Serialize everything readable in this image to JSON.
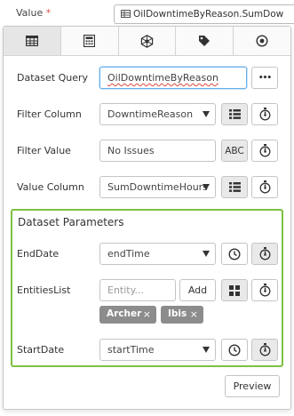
{
  "header": {
    "value_label": "Value",
    "required_mark": "*",
    "value_select": "OilDowntimeByReason.SumDow"
  },
  "tabs": [
    {
      "icon": "table-icon",
      "active": true
    },
    {
      "icon": "calculator-icon",
      "active": false
    },
    {
      "icon": "hexagon-network-icon",
      "active": false
    },
    {
      "icon": "tag-icon",
      "active": false
    },
    {
      "icon": "radio-target-icon",
      "active": false
    }
  ],
  "fields": {
    "dataset_query": {
      "label": "Dataset Query",
      "value": "OilDowntimeByReason",
      "more": "•••"
    },
    "filter_column": {
      "label": "Filter Column",
      "value": "DowntimeReason"
    },
    "filter_value": {
      "label": "Filter Value",
      "value": "No Issues",
      "type_button": "ABC"
    },
    "value_column": {
      "label": "Value Column",
      "value": "SumDowntimeHours"
    }
  },
  "params": {
    "title": "Dataset Parameters",
    "end_date": {
      "label": "EndDate",
      "value": "endTime"
    },
    "entities": {
      "label": "EntitiesList",
      "placeholder": "Entity...",
      "add": "Add",
      "tags": [
        "Archer",
        "Ibis"
      ],
      "remove": "×"
    },
    "start_date": {
      "label": "StartDate",
      "value": "startTime"
    }
  },
  "preview_button": "Preview",
  "colors": {
    "params_border": "#7dc142",
    "focus_border": "#66afe9",
    "tag_bg": "#8c8c8c"
  }
}
